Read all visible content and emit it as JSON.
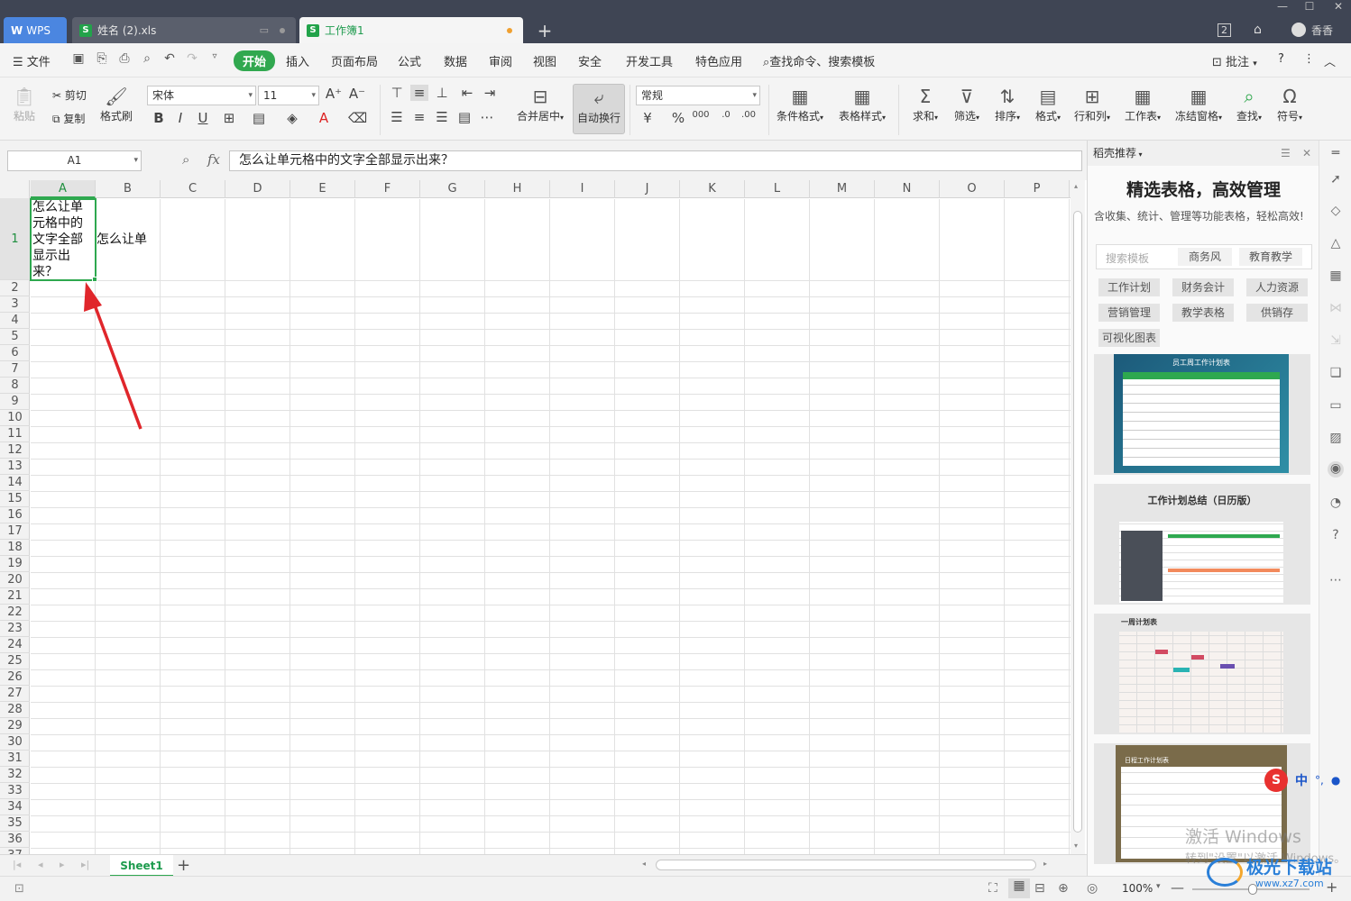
{
  "titlebar": {
    "wps_label": "WPS",
    "tab1_name": "姓名 (2).xls",
    "tab2_name": "工作簿1",
    "user_name": "香香"
  },
  "menu": {
    "file": "文件",
    "items": [
      "开始",
      "插入",
      "页面布局",
      "公式",
      "数据",
      "审阅",
      "视图",
      "安全",
      "开发工具",
      "特色应用"
    ],
    "search": "查找命令、搜索模板",
    "annotate": "批注"
  },
  "ribbon": {
    "paste": "粘贴",
    "cut": "剪切",
    "copy": "复制",
    "format_painter": "格式刷",
    "font_name": "宋体",
    "font_size": "11",
    "merge_center": "合并居中",
    "auto_wrap": "自动换行",
    "number_format": "常规",
    "cond_format": "条件格式",
    "table_style": "表格样式",
    "sum": "求和",
    "filter": "筛选",
    "sort": "排序",
    "format": "格式",
    "rows_cols": "行和列",
    "worksheet": "工作表",
    "freeze": "冻结窗格",
    "find": "查找",
    "symbol": "符号"
  },
  "formula_bar": {
    "name_box": "A1",
    "fx": "fx",
    "content": "怎么让单元格中的文字全部显示出来？"
  },
  "columns": [
    "A",
    "B",
    "C",
    "D",
    "E",
    "F",
    "G",
    "H",
    "I",
    "J",
    "K",
    "L",
    "M",
    "N",
    "O",
    "P"
  ],
  "rows": [
    "1",
    "2",
    "3",
    "4",
    "5",
    "6",
    "7",
    "8",
    "9",
    "10",
    "11",
    "12",
    "13",
    "14",
    "15",
    "16",
    "17",
    "18",
    "19",
    "20",
    "21",
    "22",
    "23",
    "24",
    "25",
    "26",
    "27",
    "28",
    "29",
    "30",
    "31",
    "32",
    "33",
    "34",
    "35",
    "36",
    "37"
  ],
  "cells": {
    "A1": "怎么让单元格中的文字全部显示出来？",
    "B1": "怎么让单"
  },
  "sheets": {
    "active": "Sheet1"
  },
  "status": {
    "zoom": "100%"
  },
  "panel": {
    "header": "稻壳推荐",
    "title": "精选表格，高效管理",
    "subtitle": "含收集、统计、管理等功能表格，轻松高效!",
    "search_placeholder": "搜索模板",
    "search_tags": [
      "商务风",
      "教育教学"
    ],
    "tags": [
      "工作计划",
      "财务会计",
      "人力资源",
      "营销管理",
      "教学表格",
      "供销存",
      "可视化图表"
    ],
    "cards": [
      "员工周工作计划表",
      "工作计划总结（日历版）",
      "一周计划表",
      "日程工作计划表"
    ]
  },
  "watermark": {
    "line1": "激活 Windows",
    "line2": "转到\"设置\"以激活 Windows。",
    "site": "极光下载站",
    "url": "www.xz7.com",
    "ime": "中"
  },
  "colors": {
    "accent": "#31a84f",
    "titlebar": "#3f4554",
    "arrow": "#e0262b"
  }
}
